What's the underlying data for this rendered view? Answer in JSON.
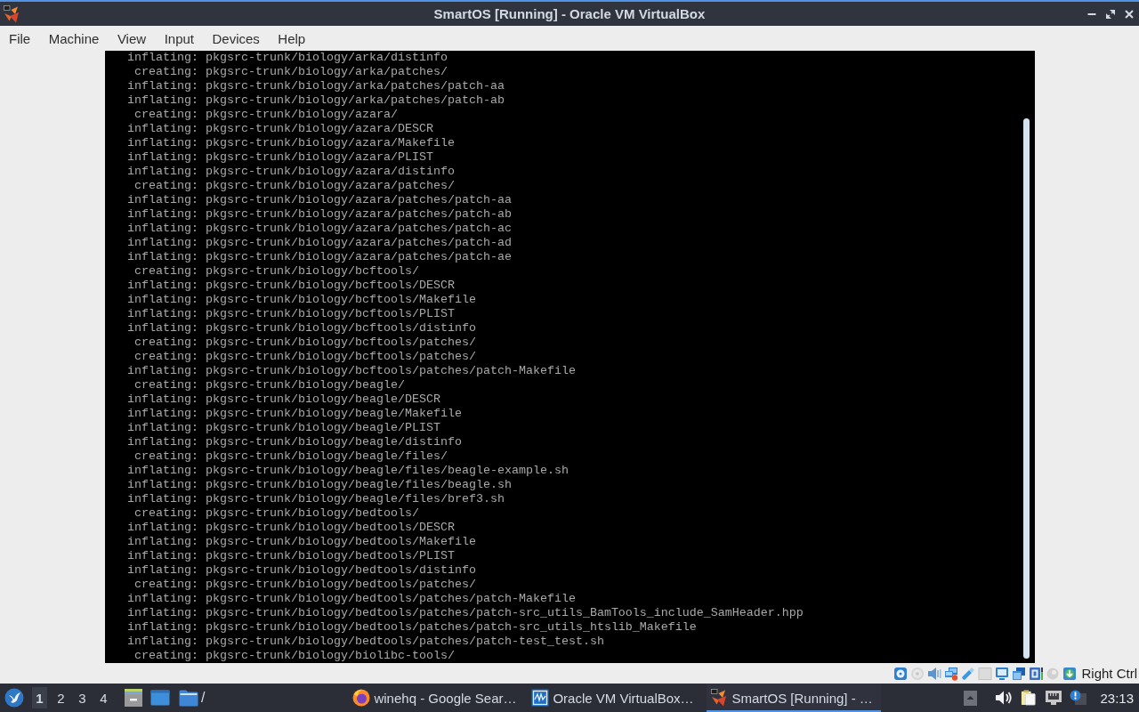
{
  "window": {
    "title": "SmartOS [Running] - Oracle VM VirtualBox"
  },
  "menu_bar": {
    "items": [
      "File",
      "Machine",
      "View",
      "Input",
      "Devices",
      "Help"
    ]
  },
  "console": {
    "lines": [
      "inflating: pkgsrc-trunk/biology/arka/distinfo",
      " creating: pkgsrc-trunk/biology/arka/patches/",
      "inflating: pkgsrc-trunk/biology/arka/patches/patch-aa",
      "inflating: pkgsrc-trunk/biology/arka/patches/patch-ab",
      " creating: pkgsrc-trunk/biology/azara/",
      "inflating: pkgsrc-trunk/biology/azara/DESCR",
      "inflating: pkgsrc-trunk/biology/azara/Makefile",
      "inflating: pkgsrc-trunk/biology/azara/PLIST",
      "inflating: pkgsrc-trunk/biology/azara/distinfo",
      " creating: pkgsrc-trunk/biology/azara/patches/",
      "inflating: pkgsrc-trunk/biology/azara/patches/patch-aa",
      "inflating: pkgsrc-trunk/biology/azara/patches/patch-ab",
      "inflating: pkgsrc-trunk/biology/azara/patches/patch-ac",
      "inflating: pkgsrc-trunk/biology/azara/patches/patch-ad",
      "inflating: pkgsrc-trunk/biology/azara/patches/patch-ae",
      " creating: pkgsrc-trunk/biology/bcftools/",
      "inflating: pkgsrc-trunk/biology/bcftools/DESCR",
      "inflating: pkgsrc-trunk/biology/bcftools/Makefile",
      "inflating: pkgsrc-trunk/biology/bcftools/PLIST",
      "inflating: pkgsrc-trunk/biology/bcftools/distinfo",
      " creating: pkgsrc-trunk/biology/bcftools/patches/",
      " creating: pkgsrc-trunk/biology/bcftools/patches/",
      "inflating: pkgsrc-trunk/biology/bcftools/patches/patch-Makefile",
      " creating: pkgsrc-trunk/biology/beagle/",
      "inflating: pkgsrc-trunk/biology/beagle/DESCR",
      "inflating: pkgsrc-trunk/biology/beagle/Makefile",
      "inflating: pkgsrc-trunk/biology/beagle/PLIST",
      "inflating: pkgsrc-trunk/biology/beagle/distinfo",
      " creating: pkgsrc-trunk/biology/beagle/files/",
      "inflating: pkgsrc-trunk/biology/beagle/files/beagle-example.sh",
      "inflating: pkgsrc-trunk/biology/beagle/files/beagle.sh",
      "inflating: pkgsrc-trunk/biology/beagle/files/bref3.sh",
      " creating: pkgsrc-trunk/biology/bedtools/",
      "inflating: pkgsrc-trunk/biology/bedtools/DESCR",
      "inflating: pkgsrc-trunk/biology/bedtools/Makefile",
      "inflating: pkgsrc-trunk/biology/bedtools/PLIST",
      "inflating: pkgsrc-trunk/biology/bedtools/distinfo",
      " creating: pkgsrc-trunk/biology/bedtools/patches/",
      "inflating: pkgsrc-trunk/biology/bedtools/patches/patch-Makefile",
      "inflating: pkgsrc-trunk/biology/bedtools/patches/patch-src_utils_BamTools_include_SamHeader.hpp",
      "inflating: pkgsrc-trunk/biology/bedtools/patches/patch-src_utils_htslib_Makefile",
      "inflating: pkgsrc-trunk/biology/bedtools/patches/patch-test_test.sh",
      " creating: pkgsrc-trunk/biology/biolibc-tools/"
    ]
  },
  "status_bar": {
    "host_key": "Right Ctrl"
  },
  "taskbar": {
    "workspaces": [
      {
        "label": "1",
        "selected": true
      },
      {
        "label": "2",
        "selected": false
      },
      {
        "label": "3",
        "selected": false
      },
      {
        "label": "4",
        "selected": false
      }
    ],
    "folder_label": "/",
    "tasks": [
      {
        "kind": "browser",
        "label": "winehq - Google Sear…",
        "selected": false
      },
      {
        "kind": "manager",
        "label": "Oracle VM VirtualBox…",
        "selected": false
      },
      {
        "kind": "machine",
        "label": "SmartOS [Running] - …",
        "selected": true
      }
    ],
    "clock": "23:13"
  }
}
